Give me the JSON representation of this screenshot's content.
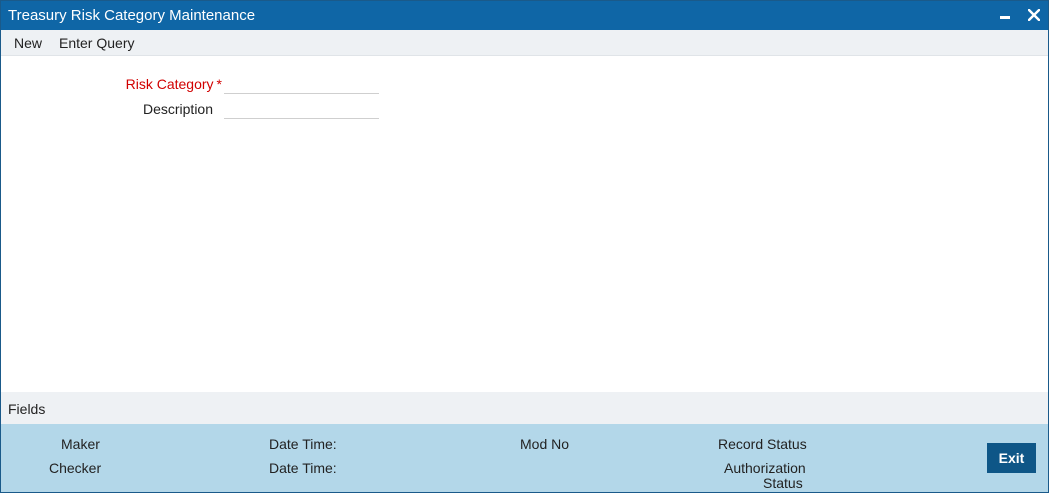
{
  "window": {
    "title": "Treasury Risk Category Maintenance",
    "minimize_icon": "minimize-icon",
    "close_icon": "close-icon"
  },
  "menu": {
    "new_label": "New",
    "enter_query_label": "Enter Query"
  },
  "form": {
    "risk_category": {
      "label": "Risk Category",
      "required_mark": "*",
      "value": ""
    },
    "description": {
      "label": "Description",
      "value": ""
    }
  },
  "fields_label": "Fields",
  "audit": {
    "maker_label": "Maker",
    "checker_label": "Checker",
    "date_time_1": "Date Time:",
    "date_time_2": "Date Time:",
    "mod_no_label": "Mod No",
    "record_status_label": "Record Status",
    "authorization_status_line1": "Authorization",
    "authorization_status_line2": "Status",
    "exit_label": "Exit"
  },
  "colors": {
    "titlebar": "#0f66a6",
    "required_label": "#d10000",
    "audit_panel": "#b3d7e9",
    "exit_button": "#0e5687"
  }
}
